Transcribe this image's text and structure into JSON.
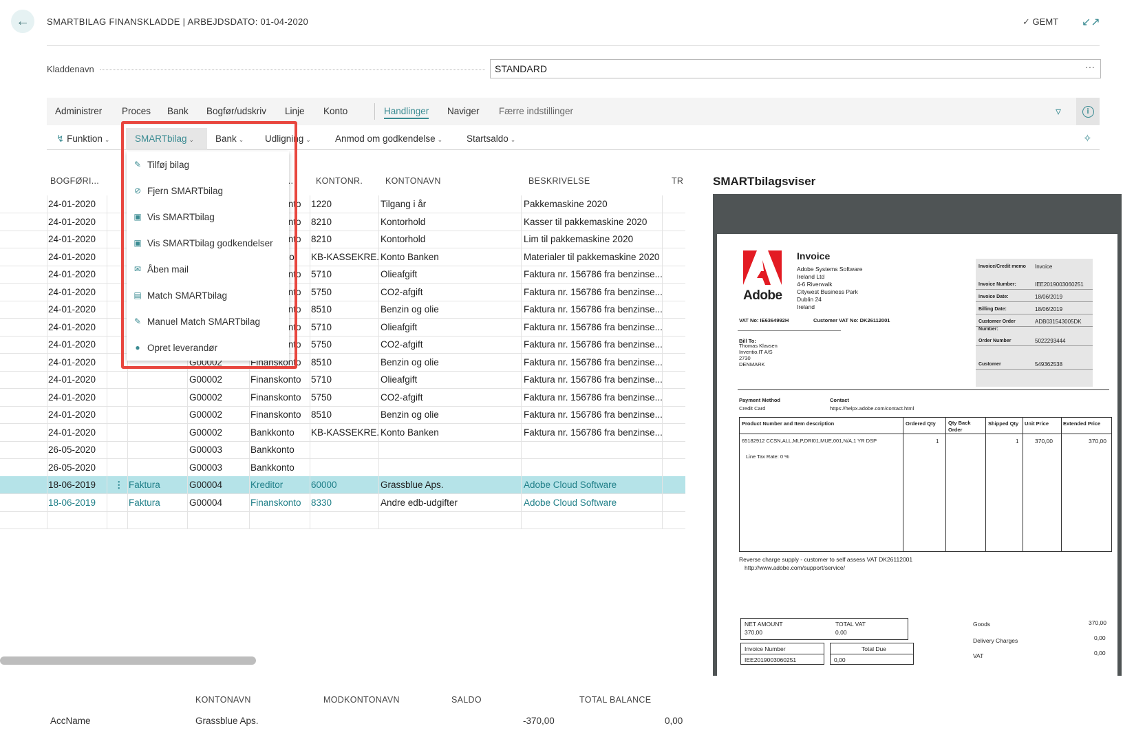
{
  "header": {
    "back_icon": "arrow-left-icon",
    "title": "SMARTBILAG FINANSKLADDE | ARBEJDSDATO: 01-04-2020",
    "saved_label": "GEMT",
    "collapse_icon": "collapse-icon"
  },
  "kladdenavn": {
    "label": "Kladdenavn",
    "value": "STANDARD",
    "more": "···"
  },
  "actionbar": {
    "items": [
      "Administrer",
      "Proces",
      "Bank",
      "Bogfør/udskriv",
      "Linje",
      "Konto",
      "Handlinger",
      "Naviger",
      "Færre indstillinger"
    ],
    "active": "Handlinger"
  },
  "subbar": {
    "items": [
      "Funktion",
      "SMARTbilag",
      "Bank",
      "Udligning",
      "Anmod om godkendelse",
      "Startsaldo"
    ],
    "active": "SMARTbilag"
  },
  "dropdown": {
    "items": [
      {
        "label": "Tilføj bilag",
        "icon": "attach-icon"
      },
      {
        "label": "Fjern SMARTbilag",
        "icon": "remove-attachment-icon"
      },
      {
        "label": "Vis SMARTbilag",
        "icon": "view-document-icon"
      },
      {
        "label": "Vis SMARTbilag godkendelser",
        "icon": "view-approvals-icon"
      },
      {
        "label": "Åben mail",
        "icon": "mail-icon"
      },
      {
        "label": "Match SMARTbilag",
        "icon": "match-icon"
      },
      {
        "label": "Manuel Match SMARTbilag",
        "icon": "manual-match-icon"
      },
      {
        "label": "Opret leverandør",
        "icon": "person-icon"
      }
    ]
  },
  "grid": {
    "headers": {
      "bogfori": "BOGFØRI...",
      "type": "TY...",
      "kontonr": "KONTONR.",
      "kontonavn": "KONTONAVN",
      "beskrivelse": "BESKRIVELSE",
      "tr": "TR"
    },
    "rows": [
      {
        "date": "24-01-2020",
        "doctype": "",
        "docno": "",
        "acctype": "Finanskonto",
        "accno": "1220",
        "accname": "Tilgang i år",
        "desc": "Pakkemaskine 2020"
      },
      {
        "date": "24-01-2020",
        "doctype": "",
        "docno": "",
        "acctype": "Finanskonto",
        "accno": "8210",
        "accname": "Kontorhold",
        "desc": "Kasser til pakkemaskine 2020"
      },
      {
        "date": "24-01-2020",
        "doctype": "",
        "docno": "",
        "acctype": "Finanskonto",
        "accno": "8210",
        "accname": "Kontorhold",
        "desc": "Lim til pakkemaskine 2020"
      },
      {
        "date": "24-01-2020",
        "doctype": "",
        "docno": "",
        "acctype": "Bankkonto",
        "accno": "KB-KASSEKRE...",
        "accname": "Konto Banken",
        "desc": "Materialer til pakkemaskine 2020"
      },
      {
        "date": "24-01-2020",
        "doctype": "",
        "docno": "",
        "acctype": "Finanskonto",
        "accno": "5710",
        "accname": "Olieafgift",
        "desc": "Faktura nr. 156786 fra benzinse..."
      },
      {
        "date": "24-01-2020",
        "doctype": "",
        "docno": "",
        "acctype": "Finanskonto",
        "accno": "5750",
        "accname": "CO2-afgift",
        "desc": "Faktura nr. 156786 fra benzinse..."
      },
      {
        "date": "24-01-2020",
        "doctype": "",
        "docno": "",
        "acctype": "Finanskonto",
        "accno": "8510",
        "accname": "Benzin og olie",
        "desc": "Faktura nr. 156786 fra benzinse..."
      },
      {
        "date": "24-01-2020",
        "doctype": "",
        "docno": "",
        "acctype": "Finanskonto",
        "accno": "5710",
        "accname": "Olieafgift",
        "desc": "Faktura nr. 156786 fra benzinse..."
      },
      {
        "date": "24-01-2020",
        "doctype": "",
        "docno": "",
        "acctype": "Finanskonto",
        "accno": "5750",
        "accname": "CO2-afgift",
        "desc": "Faktura nr. 156786 fra benzinse..."
      },
      {
        "date": "24-01-2020",
        "doctype": "",
        "docno": "G00002",
        "acctype": "Finanskonto",
        "accno": "8510",
        "accname": "Benzin og olie",
        "desc": "Faktura nr. 156786 fra benzinse..."
      },
      {
        "date": "24-01-2020",
        "doctype": "",
        "docno": "G00002",
        "acctype": "Finanskonto",
        "accno": "5710",
        "accname": "Olieafgift",
        "desc": "Faktura nr. 156786 fra benzinse..."
      },
      {
        "date": "24-01-2020",
        "doctype": "",
        "docno": "G00002",
        "acctype": "Finanskonto",
        "accno": "5750",
        "accname": "CO2-afgift",
        "desc": "Faktura nr. 156786 fra benzinse..."
      },
      {
        "date": "24-01-2020",
        "doctype": "",
        "docno": "G00002",
        "acctype": "Finanskonto",
        "accno": "8510",
        "accname": "Benzin og olie",
        "desc": "Faktura nr. 156786 fra benzinse..."
      },
      {
        "date": "24-01-2020",
        "doctype": "",
        "docno": "G00002",
        "acctype": "Bankkonto",
        "accno": "KB-KASSEKRE...",
        "accname": "Konto Banken",
        "desc": "Faktura nr. 156786 fra benzinse..."
      },
      {
        "date": "26-05-2020",
        "doctype": "",
        "docno": "G00003",
        "acctype": "Bankkonto",
        "accno": "",
        "accname": "",
        "desc": ""
      },
      {
        "date": "26-05-2020",
        "doctype": "",
        "docno": "G00003",
        "acctype": "Bankkonto",
        "accno": "",
        "accname": "",
        "desc": ""
      },
      {
        "date": "18-06-2019",
        "doctype": "Faktura",
        "docno": "G00004",
        "acctype": "Kreditor",
        "accno": "60000",
        "accname": "Grassblue Aps.",
        "desc": "Adobe Cloud Software"
      },
      {
        "date": "18-06-2019",
        "doctype": "Faktura",
        "docno": "G00004",
        "acctype": "Finanskonto",
        "accno": "8330",
        "accname": "Andre edb-udgifter",
        "desc": "Adobe Cloud Software"
      }
    ]
  },
  "footer": {
    "headers": {
      "kontonavn": "KONTONAVN",
      "modkontonavn": "MODKONTONAVN",
      "saldo": "SALDO",
      "total": "TOTAL BALANCE"
    },
    "label": "AccName",
    "kontonavn": "Grassblue Aps.",
    "saldo": "-370,00",
    "total": "0,00"
  },
  "viewer": {
    "title": "SMARTbilagsviser",
    "invoice": {
      "brand": "Adobe",
      "heading": "Invoice",
      "seller_lines": [
        "Adobe Systems Software",
        "Ireland Ltd",
        "4-6 Riverwalk",
        "Citywest Business Park",
        "Dublin 24",
        "Ireland"
      ],
      "vat_no": "VAT No:  IE6364992H",
      "customer_vat": "Customer VAT No: DK26112001",
      "meta": [
        {
          "k": "Invoice/Credit memo",
          "v": "Invoice"
        },
        {
          "k": "Invoice Number:",
          "v": "IEE2019003060251"
        },
        {
          "k": "Invoice Date:",
          "v": "18/06/2019"
        },
        {
          "k": "Billing Date:",
          "v": "18/06/2019"
        },
        {
          "k": "Customer Order Number:",
          "v": "ADB031543005DK"
        },
        {
          "k": "Order Number",
          "v": "5022293444"
        },
        {
          "k": "Customer",
          "v": "549362538"
        }
      ],
      "bill_to_label": "Bill To:",
      "bill_to": [
        "Thomas Klavsen",
        "Inventio.IT A/S",
        "2730",
        "DENMARK"
      ],
      "payment_method_label": "Payment Method",
      "payment_method": "Credit Card",
      "contact_label": "Contact",
      "contact": "https://helpx.adobe.com/contact.html",
      "cols": [
        "Product Number and Item description",
        "Ordered Qty",
        "Qty Back Order",
        "Shipped Qty",
        "Unit Price",
        "Extended Price"
      ],
      "line_item": "65182912      CCSN,ALL,MLP,DRI01,MUE,001,N/A,1 YR DSP",
      "ordered": "1",
      "shipped": "1",
      "unit_price": "370,00",
      "ext_price": "370,00",
      "tax_rate": "Line Tax Rate: 0    %",
      "reverse_charge": "Reverse charge supply - customer to self assess VAT  DK26112001",
      "support_url": "http://www.adobe.com/support/service/",
      "net_amount_label": "NET AMOUNT",
      "net_amount": "370,00",
      "total_vat_label": "TOTAL VAT",
      "total_vat": "0,00",
      "invoice_number_label": "Invoice Number",
      "invoice_number": "IEE2019003060251",
      "total_due_label": "Total Due",
      "total_due": "0,00",
      "goods_label": "Goods",
      "goods": "370,00",
      "delivery_label": "Delivery Charges",
      "delivery": "0,00",
      "vat_label": "VAT",
      "vat": "0,00"
    }
  }
}
